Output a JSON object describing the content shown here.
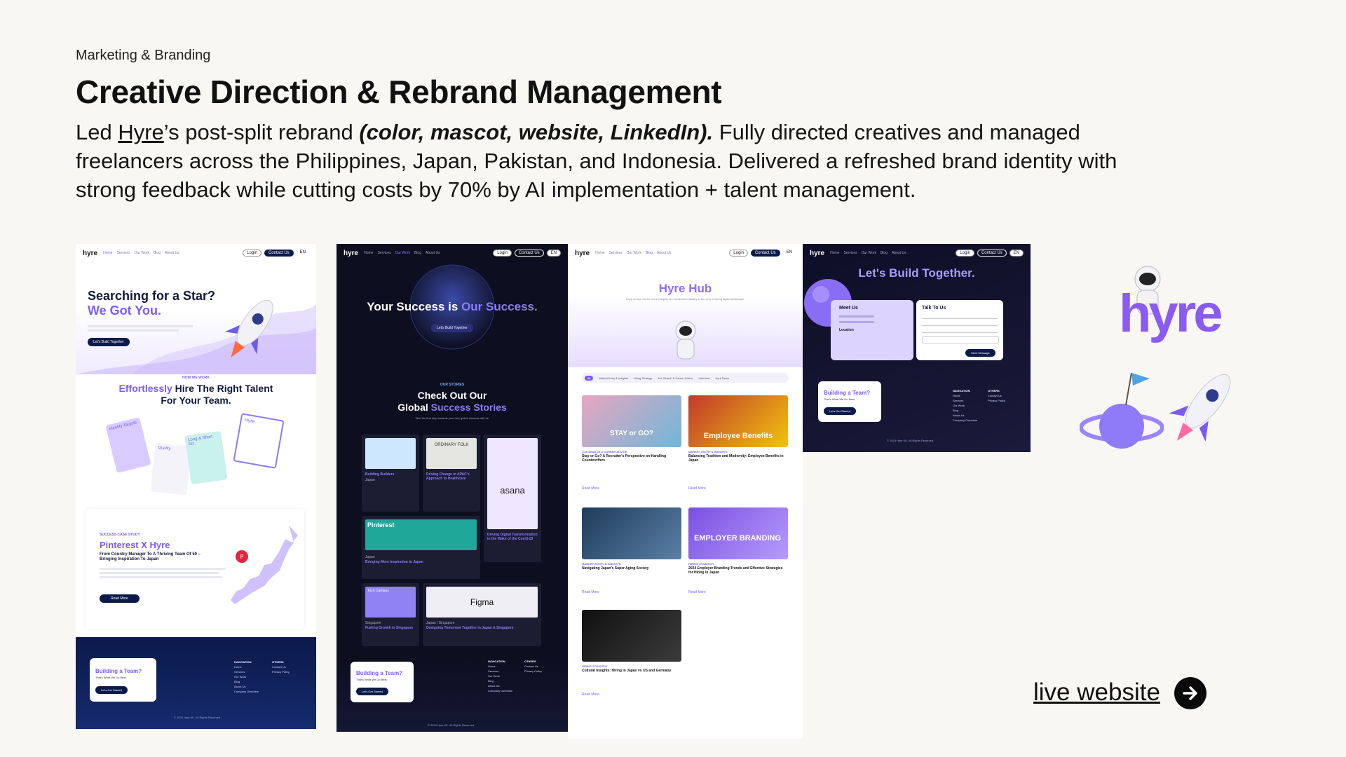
{
  "header": {
    "eyebrow": "Marketing & Branding",
    "title": "Creative Direction & Rebrand Management",
    "desc_prefix": "Led ",
    "desc_link": "Hyre",
    "desc_after_link": "’s post-split rebrand ",
    "desc_emph": "(color, mascot, website, LinkedIn).",
    "desc_suffix": " Fully directed creatives and managed freelancers across the Philippines, Japan, Pakistan, and Indonesia. Delivered a refreshed brand identity with strong feedback while cutting costs by 70% by AI implementation + talent management."
  },
  "shot1": {
    "logo": "hyre",
    "nav_links": [
      "Home",
      "Services",
      "Our Work",
      "Blog",
      "About Us"
    ],
    "login": "Login",
    "contact": "Contact Us",
    "lang": "EN",
    "hero_title_line1": "Searching for a Star?",
    "hero_title_line2": "We Got You.",
    "hero_button": "Let's Build Together",
    "how_label": "HOW WE WORK",
    "how_title_a": "Effortlessly",
    "how_title_b": " Hire The Right Talent For Your Team.",
    "card_texts": [
      "Identify Targets",
      "Quality",
      "Long & Short list",
      "Hyre."
    ],
    "case_label": "SUCCESS CASE STUDY",
    "case_title": "Pinterest X Hyre",
    "case_subtitle": "From Country Manager To A Thriving Team Of 50 – Bringing Inspiration To Japan",
    "case_button": "Read More",
    "footer_cta": "Building a Team?",
    "footer_cta_sub": "That's What We Do Best.",
    "footer_button": "Let's Get Started",
    "footer_nav_title": "NAVIGATION",
    "footer_nav": [
      "Home",
      "Services",
      "Our Work",
      "Blog",
      "About Us",
      "Company Overview"
    ],
    "footer_others_title": "OTHERS",
    "footer_others": [
      "Contact Us",
      "Privacy Policy"
    ],
    "copyright": "© 2024 Hyre KK. All Rights Reserved."
  },
  "shot2": {
    "logo": "hyre",
    "nav_links": [
      "Home",
      "Services",
      "Our Work",
      "Blog",
      "About Us"
    ],
    "login": "Login",
    "contact": "Contact Us",
    "lang": "EN",
    "hero_a": "Your Success is ",
    "hero_b": "Our Success.",
    "hero_button": "Let's Build Together",
    "stories_label": "OUR STORIES",
    "stories_title_a": "Check Out Our",
    "stories_title_b": "Global ",
    "stories_title_c": "Success Stories",
    "stories_sub": "Take the first step towards your own global success with us.",
    "tiles": [
      {
        "label": "Building Builders",
        "sub": "Japan"
      },
      {
        "label": "Driving Change in APAC's Approach to Healthcare",
        "sub": "Japan"
      },
      {
        "label": "Driving Digital Transformation in the Wake of the Covid-19",
        "sub": "Japan"
      },
      {
        "label": "Bringing More Inspiration to Japan",
        "sub": "Japan"
      },
      {
        "label": "Fueling Growth in Singapore",
        "sub": "Singapore"
      },
      {
        "label": "Designing Tomorrow Together in Japan & Singapore",
        "sub": "Japan / Singapore"
      }
    ],
    "tile_brands": [
      "ORDINARY FOLK",
      "asana",
      "Pinterest",
      "Figma",
      "Tech Campus"
    ],
    "footer_cta": "Building a Team?",
    "footer_cta_sub": "That's What We Do Best.",
    "footer_button": "Let's Get Started",
    "footer_nav_title": "NAVIGATION",
    "footer_nav": [
      "Home",
      "Services",
      "Our Work",
      "Blog",
      "About Us",
      "Company Overview"
    ],
    "footer_others_title": "OTHERS",
    "footer_others": [
      "Contact Us",
      "Privacy Policy"
    ],
    "copyright": "© 2024 Hyre KK. All Rights Reserved."
  },
  "shot3": {
    "logo": "hyre",
    "nav_links": [
      "Home",
      "Services",
      "Our Work",
      "Blog",
      "About Us"
    ],
    "login": "Login",
    "contact": "Contact Us",
    "lang": "EN",
    "hub_title": "Hyre Hub",
    "hub_sub": "Keep an eye out for more insights on recruitment industry in the ever evolving digital landscape.",
    "filters": [
      "All",
      "Market Entry & Insights",
      "Hiring Strategy",
      "Job Search & Career Advice",
      "Interview",
      "Hyre News"
    ],
    "posts": [
      {
        "img": "STAY or GO?",
        "tag": "JOB SEARCH & CAREER ADVICE",
        "title": "Stay or Go? A Recruiter's Perspective on Handling Counteroffers"
      },
      {
        "img": "Employee Benefits",
        "tag": "MARKET ENTRY & INSIGHTS",
        "title": "Balancing Tradition and Modernity: Employee Benefits in Japan"
      },
      {
        "img": "",
        "tag": "MARKET ENTRY & INSIGHTS",
        "title": "Navigating Japan's Super Aging Society"
      },
      {
        "img": "EMPLOYER BRANDING",
        "tag": "HIRING STRATEGY",
        "title": "2024 Employer Branding Trends and Effective Strategies for Hiring in Japan"
      },
      {
        "img": "",
        "tag": "HIRING STRATEGY",
        "title": "Cultural Insights: Hiring in Japan vs US and Germany"
      }
    ],
    "read_more": "Read More"
  },
  "shot4": {
    "logo": "hyre",
    "nav_links": [
      "Home",
      "Services",
      "Our Work",
      "Blog",
      "About Us"
    ],
    "login": "Login",
    "contact": "Contact Us",
    "lang": "EN",
    "title": "Let's Build Together.",
    "meet_title": "Meet Us",
    "location_title": "Location",
    "talk_title": "Talk To Us",
    "send_button": "Send Message",
    "footer_cta": "Building a Team?",
    "footer_cta_sub": "That's What We Do Best.",
    "footer_button": "Let's Get Started",
    "footer_nav_title": "NAVIGATION",
    "footer_nav": [
      "Home",
      "Services",
      "Our Work",
      "Blog",
      "About Us",
      "Company Overview"
    ],
    "footer_others_title": "OTHERS",
    "footer_others": [
      "Contact Us",
      "Privacy Policy"
    ],
    "copyright": "© 2024 Hyre KK. All Rights Reserved."
  },
  "logo_art": {
    "wordmark": "hyre"
  },
  "cta": {
    "live_label": "live website"
  },
  "colors": {
    "accent_purple": "#7b5cf0",
    "navy": "#0b1a4a",
    "dark_bg": "#0d0e1f",
    "page_bg": "#f8f7f3"
  }
}
